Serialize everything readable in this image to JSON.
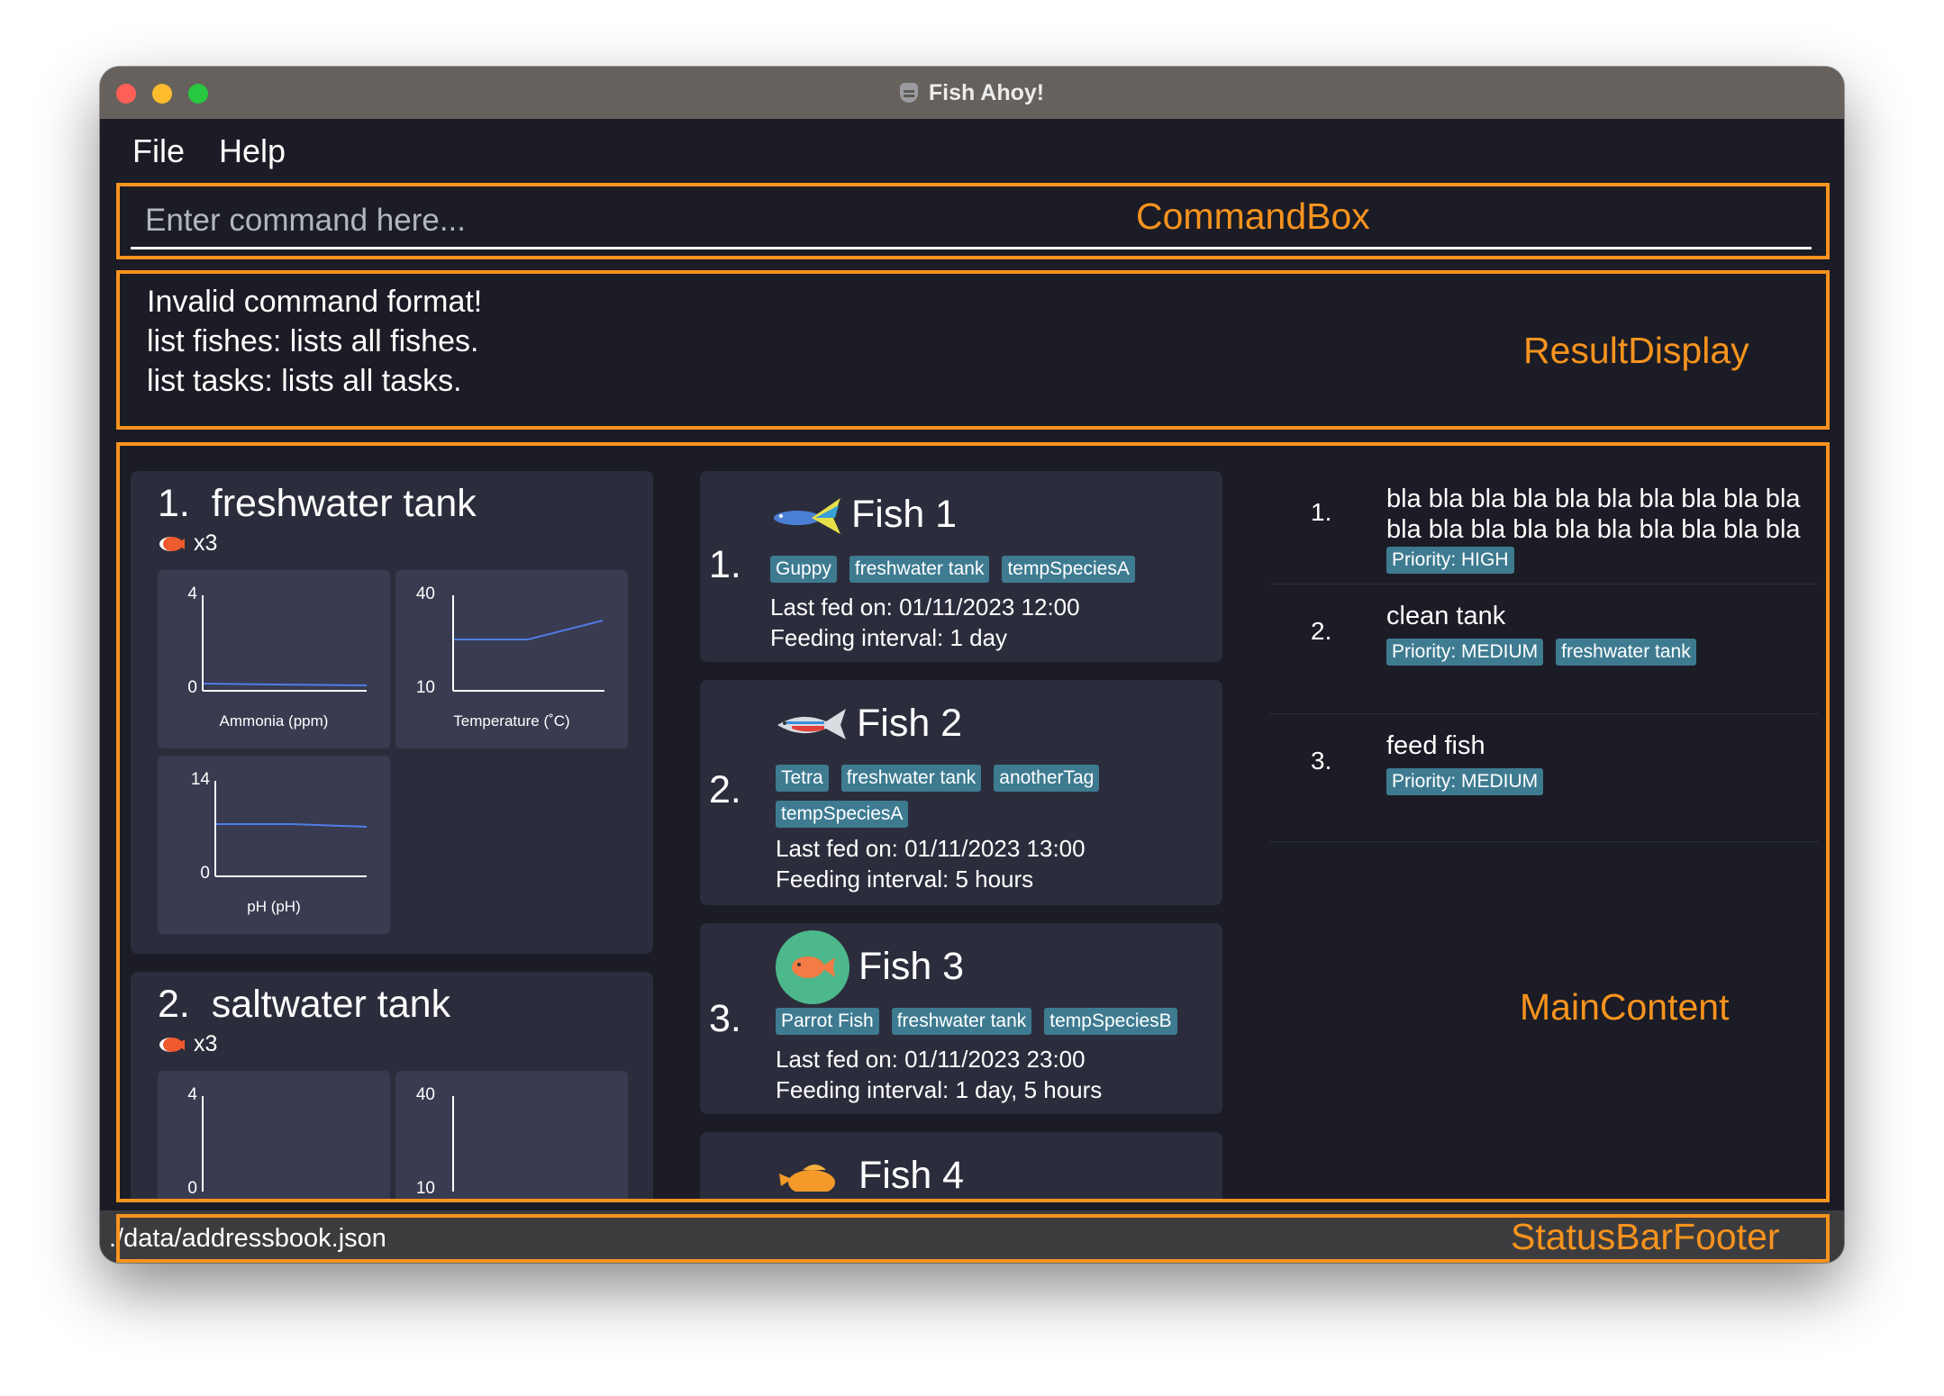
{
  "window": {
    "title": "Fish Ahoy!"
  },
  "menu": {
    "file": "File",
    "help": "Help"
  },
  "command_box": {
    "placeholder": "Enter command here...",
    "label": "CommandBox"
  },
  "result_display": {
    "lines": [
      "Invalid command format!",
      "list fishes: lists all fishes.",
      "list tasks: lists all tasks."
    ],
    "label": "ResultDisplay"
  },
  "main_content": {
    "label": "MainContent"
  },
  "status_bar": {
    "path": "./data/addressbook.json",
    "label": "StatusBarFooter"
  },
  "tanks": [
    {
      "index": "1.",
      "name": "freshwater tank",
      "count": "x3",
      "graphs": {
        "ammonia": {
          "label": "Ammonia (ppm)",
          "ymax": "4",
          "ymin": "0"
        },
        "temperature": {
          "label": "Temperature (˚C)",
          "ymax": "40",
          "ymin": "10"
        },
        "ph": {
          "label": "pH (pH)",
          "ymax": "14",
          "ymin": "0"
        }
      }
    },
    {
      "index": "2.",
      "name": "saltwater tank",
      "count": "x3",
      "graphs": {
        "ammonia": {
          "ymax": "4",
          "ymin": "0"
        },
        "temperature": {
          "ymax": "40",
          "ymin": "10"
        }
      }
    }
  ],
  "fishes": [
    {
      "index": "1.",
      "name": "Fish 1",
      "tags": [
        "Guppy",
        "freshwater tank",
        "tempSpeciesA"
      ],
      "last_fed": "Last fed on: 01/11/2023 12:00",
      "interval": "Feeding interval: 1 day"
    },
    {
      "index": "2.",
      "name": "Fish 2",
      "tags": [
        "Tetra",
        "freshwater tank",
        "anotherTag",
        "tempSpeciesA"
      ],
      "last_fed": "Last fed on: 01/11/2023 13:00",
      "interval": "Feeding interval: 5 hours"
    },
    {
      "index": "3.",
      "name": "Fish 3",
      "tags": [
        "Parrot Fish",
        "freshwater tank",
        "tempSpeciesB"
      ],
      "last_fed": "Last fed on: 01/11/2023 23:00",
      "interval": "Feeding interval: 1 day, 5 hours"
    },
    {
      "index": "",
      "name": "Fish 4"
    }
  ],
  "tasks": [
    {
      "index": "1.",
      "description": "bla bla bla bla bla bla bla bla bla bla bla bla bla bla bla bla bla bla bla bla",
      "tags": [
        "Priority: HIGH"
      ]
    },
    {
      "index": "2.",
      "description": "clean tank",
      "tags": [
        "Priority: MEDIUM",
        "freshwater tank"
      ]
    },
    {
      "index": "3.",
      "description": "feed fish",
      "tags": [
        "Priority: MEDIUM"
      ]
    }
  ],
  "colors": {
    "accent": "#f7931e",
    "tag": "#3e7b91",
    "card": "#2c2d3c",
    "background": "#1b1c25"
  }
}
